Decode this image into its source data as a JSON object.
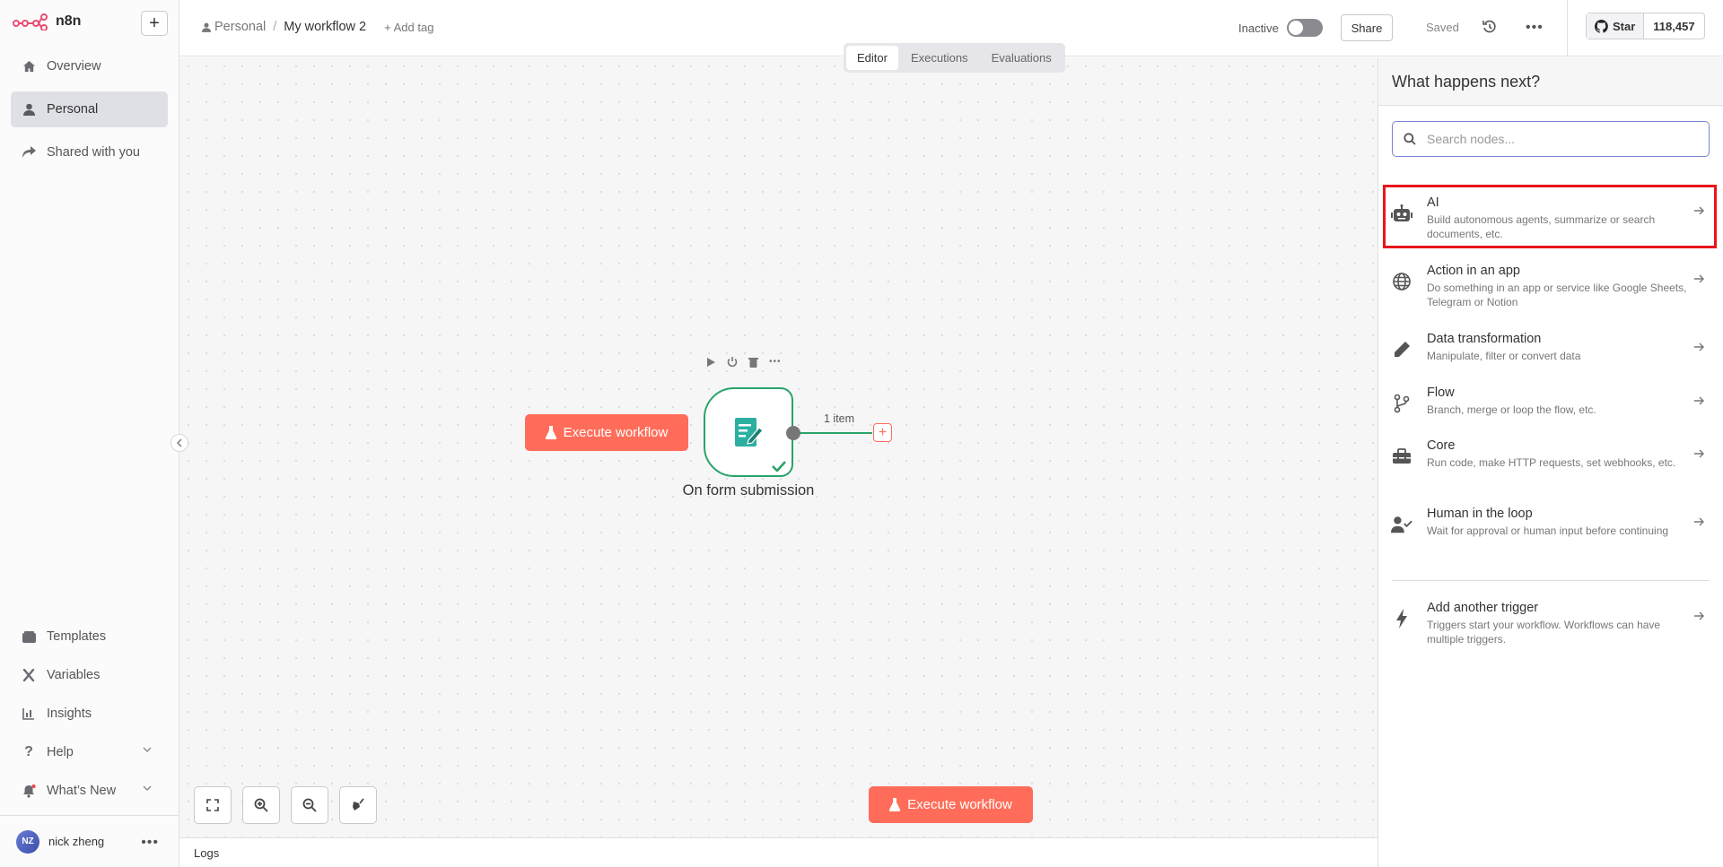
{
  "app": {
    "logo_text": "n8n"
  },
  "sidebar": {
    "items": [
      {
        "label": "Overview"
      },
      {
        "label": "Personal"
      },
      {
        "label": "Shared with you"
      }
    ],
    "bottom_items": [
      {
        "label": "Templates"
      },
      {
        "label": "Variables"
      },
      {
        "label": "Insights"
      },
      {
        "label": "Help"
      },
      {
        "label": "What’s New"
      }
    ],
    "user": {
      "initials": "NZ",
      "name": "nick zheng"
    }
  },
  "header": {
    "breadcrumb_home": "Personal",
    "breadcrumb_sep": "/",
    "workflow_name": "My workflow 2",
    "add_tag": "+ Add tag",
    "status_label": "Inactive",
    "share_label": "Share",
    "saved_label": "Saved",
    "github": {
      "star_label": "Star",
      "star_count": "118,457"
    }
  },
  "tabs": [
    {
      "label": "Editor",
      "active": true
    },
    {
      "label": "Executions",
      "active": false
    },
    {
      "label": "Evaluations",
      "active": false
    }
  ],
  "canvas": {
    "execute_label": "Execute workflow",
    "node_name": "On form submission",
    "connection_label": "1 item",
    "bottom_execute_label": "Execute workflow"
  },
  "logs": {
    "label": "Logs"
  },
  "panel": {
    "title": "What happens next?",
    "search_placeholder": "Search nodes...",
    "categories": [
      {
        "title": "AI",
        "description": "Build autonomous agents, summarize or search documents, etc.",
        "icon": "robot-icon",
        "highlighted": true
      },
      {
        "title": "Action in an app",
        "description": "Do something in an app or service like Google Sheets, Telegram or Notion",
        "icon": "globe-icon"
      },
      {
        "title": "Data transformation",
        "description": "Manipulate, filter or convert data",
        "icon": "pen-icon"
      },
      {
        "title": "Flow",
        "description": "Branch, merge or loop the flow, etc.",
        "icon": "branch-icon"
      },
      {
        "title": "Core",
        "description": "Run code, make HTTP requests, set webhooks, etc.",
        "icon": "toolbox-icon"
      },
      {
        "title": "Human in the loop",
        "description": "Wait for approval or human input before continuing",
        "icon": "user-check-icon"
      }
    ],
    "trigger": {
      "title": "Add another trigger",
      "description": "Triggers start your workflow. Workflows can have multiple triggers.",
      "icon": "bolt-icon"
    }
  },
  "colors": {
    "accent": "#ff6d5a",
    "success": "#29a36a",
    "highlight": "#e8151b"
  }
}
